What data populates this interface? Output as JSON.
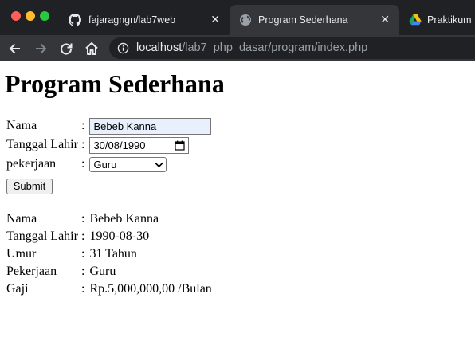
{
  "browser": {
    "tabs": [
      {
        "title": "fajaragngn/lab7web",
        "favicon": "github-icon"
      },
      {
        "title": "Program Sederhana",
        "favicon": "globe-icon",
        "active": true
      },
      {
        "title": "Praktikum",
        "favicon": "google-drive-icon"
      }
    ],
    "close_glyph": "✕",
    "address": {
      "host": "localhost",
      "path": "/lab7_php_dasar/program/index.php"
    }
  },
  "page": {
    "heading": "Program Sederhana",
    "separator": ":",
    "form": {
      "nama_label": "Nama",
      "nama_value": "Bebeb Kanna",
      "tanggal_label": "Tanggal Lahir",
      "tanggal_value": "30/08/1990",
      "pekerjaan_label": "pekerjaan",
      "pekerjaan_value": "Guru",
      "submit_label": "Submit"
    },
    "result": [
      {
        "label": "Nama",
        "value": "Bebeb Kanna"
      },
      {
        "label": "Tanggal Lahir",
        "value": "1990-08-30"
      },
      {
        "label": "Umur",
        "value": "31 Tahun"
      },
      {
        "label": "Pekerjaan",
        "value": "Guru"
      },
      {
        "label": "Gaji",
        "value": "Rp.5,000,000,00 /Bulan"
      }
    ]
  },
  "colors": {
    "tabstrip": "#202124",
    "toolbar": "#35363a",
    "autofill": "#e8f0fe"
  }
}
